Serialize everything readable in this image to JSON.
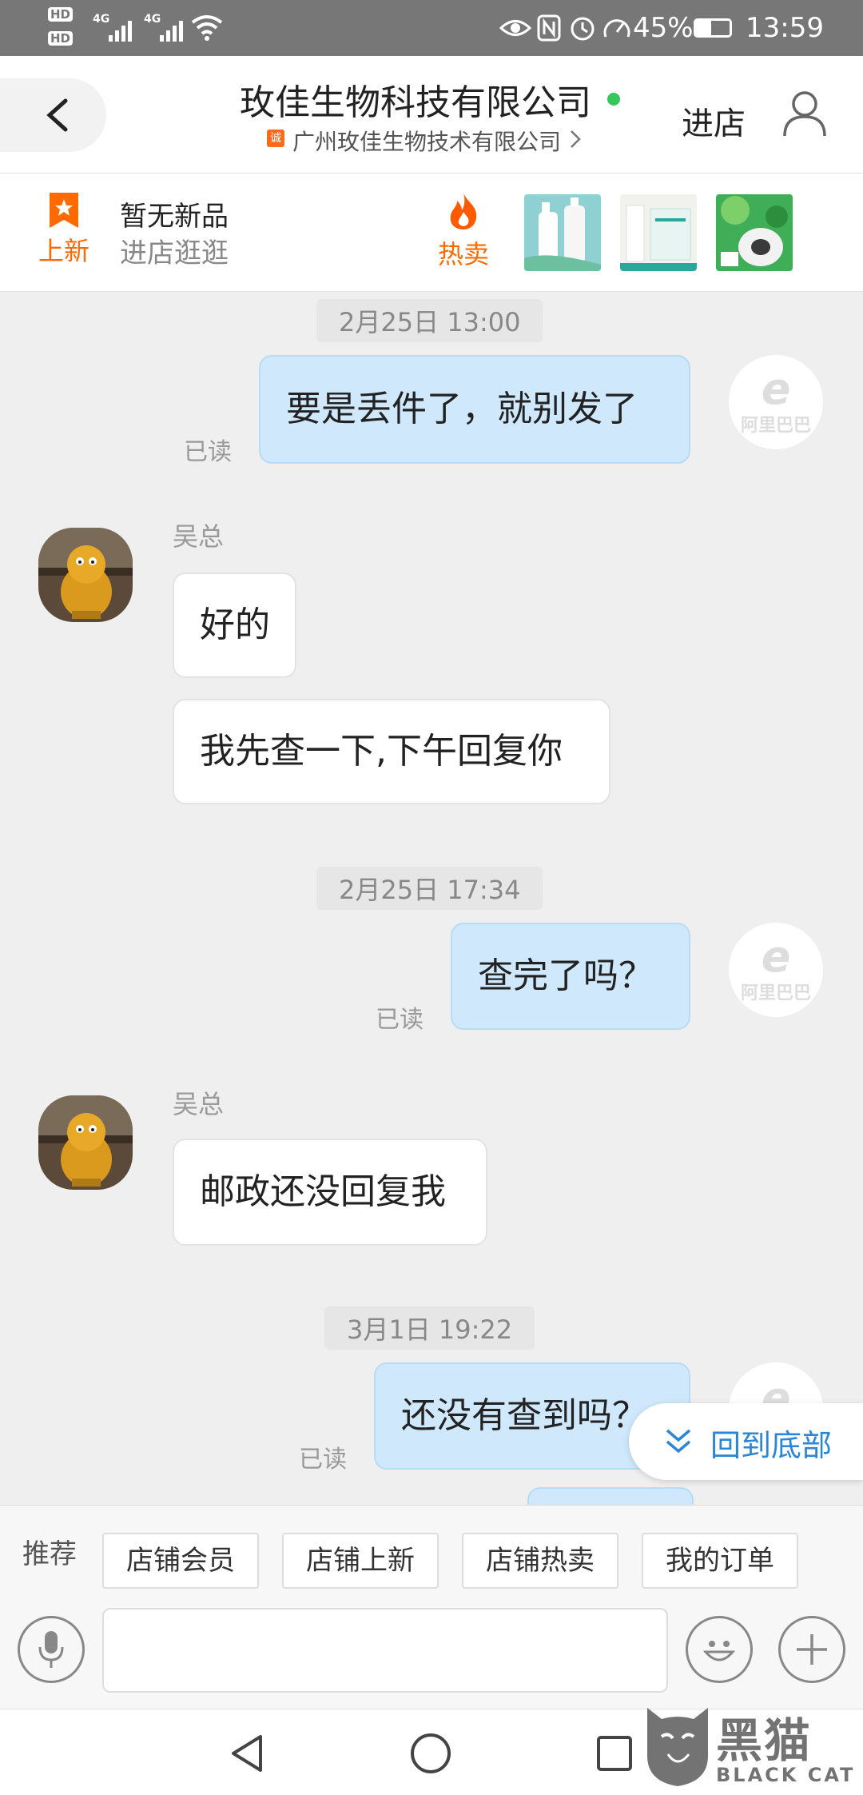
{
  "status_bar": {
    "hd1": "HD",
    "hd2": "HD",
    "sig1": "4G",
    "sig2": "4G",
    "battery": "45%",
    "time": "13:59"
  },
  "header": {
    "title": "玫佳生物科技有限公司",
    "subtitle": "广州玫佳生物技术有限公司",
    "badge": "诚",
    "enter_store": "进店"
  },
  "promo": {
    "new_label": "上新",
    "no_new_title": "暂无新品",
    "no_new_sub": "进店逛逛",
    "hot_label": "热卖"
  },
  "chat": {
    "messages": [
      {
        "type": "time",
        "text": "2月25日 13:00"
      },
      {
        "type": "out",
        "text": "要是丢件了，就别发了",
        "status": "已读",
        "avatar_text": "阿里巴巴"
      },
      {
        "type": "in",
        "sender": "吴总",
        "texts": [
          "好的",
          "我先查一下,下午回复你"
        ]
      },
      {
        "type": "time",
        "text": "2月25日 17:34"
      },
      {
        "type": "out",
        "text": "查完了吗？",
        "status": "已读",
        "avatar_text": "阿里巴巴"
      },
      {
        "type": "in",
        "sender": "吴总",
        "texts": [
          "邮政还没回复我"
        ]
      },
      {
        "type": "time",
        "text": "3月1日 19:22"
      },
      {
        "type": "out",
        "text": "还没有查到吗？",
        "status": "已读"
      }
    ]
  },
  "back_to_bottom": "回到底部",
  "quick_actions": {
    "label": "推荐",
    "items": [
      "店铺会员",
      "店铺上新",
      "店铺热卖",
      "我的订单"
    ]
  },
  "watermark": {
    "cn": "黑猫",
    "en": "BLACK CAT"
  },
  "colors": {
    "accent": "#ff6a00",
    "link": "#2a86d6",
    "bubble_out": "#cfe8fb"
  }
}
